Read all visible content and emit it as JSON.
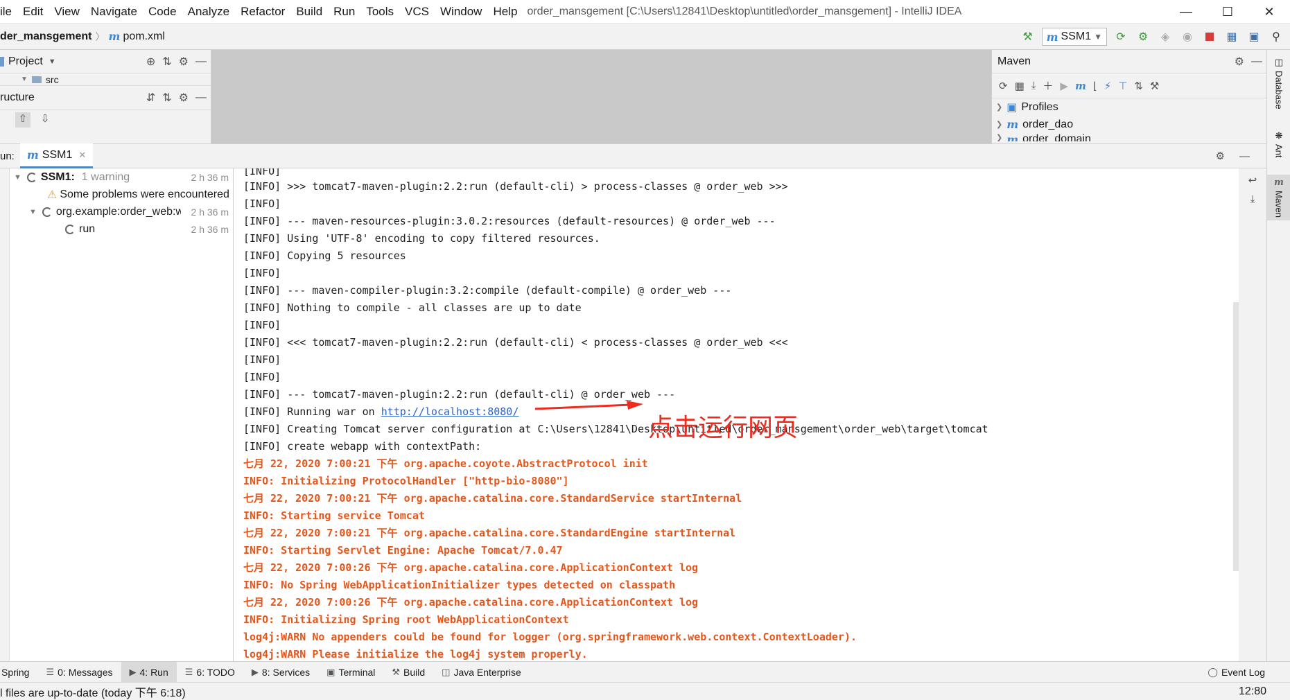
{
  "menu": [
    "ile",
    "Edit",
    "View",
    "Navigate",
    "Code",
    "Analyze",
    "Refactor",
    "Build",
    "Run",
    "Tools",
    "VCS",
    "Window",
    "Help"
  ],
  "window_title": "order_mansgement [C:\\Users\\12841\\Desktop\\untitled\\order_mansgement] - IntelliJ IDEA",
  "window_controls": {
    "minimize": "—",
    "maximize": "☐",
    "close": "✕"
  },
  "breadcrumb": {
    "project": "der_mansgement",
    "file_icon": "m",
    "file": "pom.xml"
  },
  "toolbar": {
    "run_config_icon": "m",
    "run_config": "SSM1"
  },
  "project_panel": {
    "title": "Project",
    "tree_item": "src"
  },
  "structure_panel": {
    "title": "ructure"
  },
  "maven_panel": {
    "title": "Maven",
    "items": [
      "Profiles",
      "order_dao",
      "order_domain"
    ]
  },
  "right_stripe": [
    "Database",
    "Ant",
    "Maven"
  ],
  "run": {
    "label": "un:",
    "tab_icon": "m",
    "tab": "SSM1",
    "tree": [
      {
        "label": "SSM1:",
        "extra": "1 warning",
        "time": "2 h 36 m"
      },
      {
        "label": "Some problems were encountered",
        "time": ""
      },
      {
        "label": "org.example:order_web:war",
        "time": "2 h 36 m"
      },
      {
        "label": "run",
        "time": "2 h 36 m"
      }
    ]
  },
  "console": {
    "lines": [
      "[INFO]",
      "[INFO] >>> tomcat7-maven-plugin:2.2:run (default-cli) > process-classes @ order_web >>>",
      "[INFO]",
      "[INFO] --- maven-resources-plugin:3.0.2:resources (default-resources) @ order_web ---",
      "[INFO] Using 'UTF-8' encoding to copy filtered resources.",
      "[INFO] Copying 5 resources",
      "[INFO]",
      "[INFO] --- maven-compiler-plugin:3.2:compile (default-compile) @ order_web ---",
      "[INFO] Nothing to compile - all classes are up to date",
      "[INFO]",
      "[INFO] <<< tomcat7-maven-plugin:2.2:run (default-cli) < process-classes @ order_web <<<",
      "[INFO]",
      "[INFO]",
      "[INFO] --- tomcat7-maven-plugin:2.2:run (default-cli) @ order_web ---"
    ],
    "running_prefix": "[INFO] Running war on ",
    "running_link": "http://localhost:8080/",
    "lines_after": [
      "[INFO] Creating Tomcat server configuration at C:\\Users\\12841\\Desktop\\untitled\\order_mansgement\\order_web\\target\\tomcat",
      "[INFO] create webapp with contextPath:"
    ],
    "red_lines": [
      "七月 22, 2020 7:00:21 下午 org.apache.coyote.AbstractProtocol init",
      "INFO: Initializing ProtocolHandler [\"http-bio-8080\"]",
      "七月 22, 2020 7:00:21 下午 org.apache.catalina.core.StandardService startInternal",
      "INFO: Starting service Tomcat",
      "七月 22, 2020 7:00:21 下午 org.apache.catalina.core.StandardEngine startInternal",
      "INFO: Starting Servlet Engine: Apache Tomcat/7.0.47",
      "七月 22, 2020 7:00:26 下午 org.apache.catalina.core.ApplicationContext log",
      "INFO: No Spring WebApplicationInitializer types detected on classpath",
      "七月 22, 2020 7:00:26 下午 org.apache.catalina.core.ApplicationContext log",
      "INFO: Initializing Spring root WebApplicationContext",
      "log4j:WARN No appenders could be found for logger (org.springframework.web.context.ContextLoader).",
      "log4j:WARN Please initialize the log4j system properly."
    ]
  },
  "annotation": "点击运行网页",
  "bottom_tabs": [
    {
      "label": "Spring"
    },
    {
      "label": "0: Messages"
    },
    {
      "label": "4: Run"
    },
    {
      "label": "6: TODO"
    },
    {
      "label": "8: Services"
    },
    {
      "label": "Terminal"
    },
    {
      "label": "Build"
    },
    {
      "label": "Java Enterprise"
    }
  ],
  "event_log": "Event Log",
  "status": {
    "message": "l files are up-to-date (today 下午 6:18)",
    "time": "12:80"
  },
  "colors": {
    "accent": "#4a88c7",
    "error_text": "#e5561b",
    "annotation": "#ee2b1e",
    "link": "#2a62c9"
  }
}
